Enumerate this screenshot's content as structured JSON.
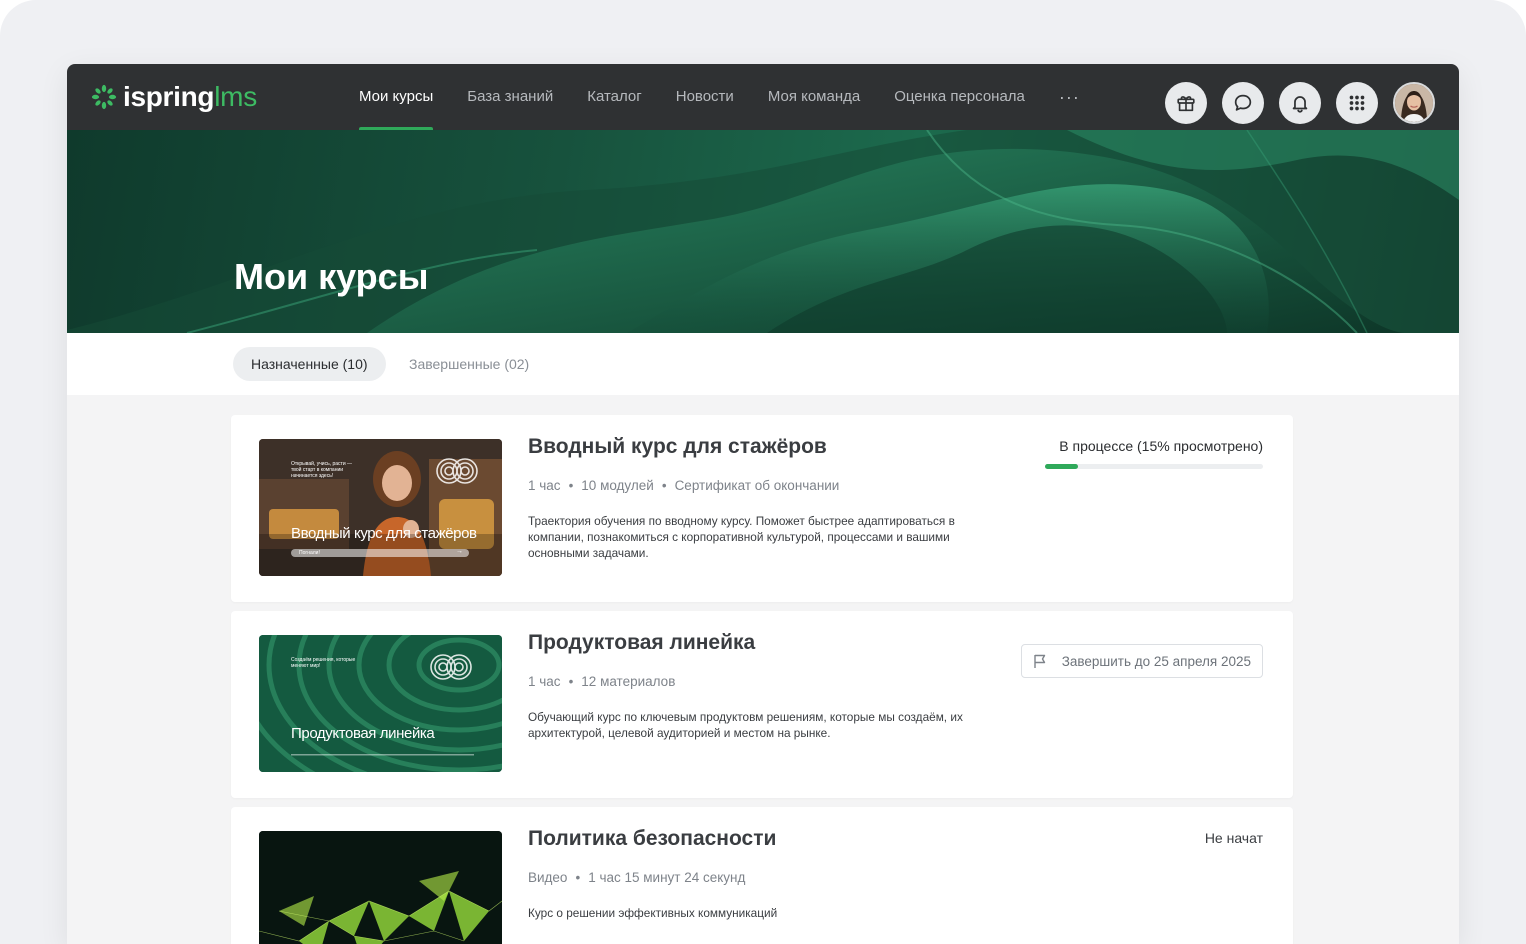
{
  "app": {
    "logo_word_1": "ispring",
    "logo_word_2": "lms"
  },
  "nav": {
    "items": [
      {
        "label": "Мои курсы",
        "active": true
      },
      {
        "label": "База знаний",
        "active": false
      },
      {
        "label": "Каталог",
        "active": false
      },
      {
        "label": "Новости",
        "active": false
      },
      {
        "label": "Моя команда",
        "active": false
      },
      {
        "label": "Оценка персонала",
        "active": false
      }
    ],
    "more": "···",
    "icons": [
      "gift-icon",
      "chat-icon",
      "bell-icon",
      "apps-grid-icon"
    ]
  },
  "hero": {
    "title": "Мои курсы"
  },
  "tabs": [
    {
      "label": "Назначенные (10)",
      "active": true
    },
    {
      "label": "Завершенные (02)",
      "active": false
    }
  ],
  "courses": [
    {
      "title": "Вводный курс для стажёров",
      "meta": [
        "1 час",
        "10 модулей",
        "Сертификат об окончании"
      ],
      "description": "Траектория обучения по вводному курсу. Поможет быстрее адаптироваться в компании, познакомиться с корпоративной культурой, процессами и вашими основными задачами.",
      "status": "В процессе (15% просмотрено)",
      "progress": 0.15,
      "thumb_small": "Открывай, учись, расти — твой старт в компании начинается здесь!",
      "thumb_big": "Вводный курс для стажёров",
      "thumb_button": "Погнали!"
    },
    {
      "title": "Продуктовая линейка",
      "meta": [
        "1 час",
        "12 материалов"
      ],
      "description": "Обучающий курс по ключевым продуктовм решениям, которые мы создаём, их архитектурой, целевой аудиторией и местом на рынке.",
      "deadline": "Завершить до 25 апреля 2025",
      "thumb_small": "Создаём решения, которые меняют мир!",
      "thumb_big": "Продуктовая линейка"
    },
    {
      "title": "Политика безопасности",
      "meta": [
        "Видео",
        "1 час 15 минут 24 секунд"
      ],
      "description": "Курс о решении эффективных коммуникаций",
      "status": "Не начат"
    }
  ],
  "colors": {
    "accent": "#2fa95a",
    "topbar": "#2f3133",
    "hero": "#17523d"
  }
}
